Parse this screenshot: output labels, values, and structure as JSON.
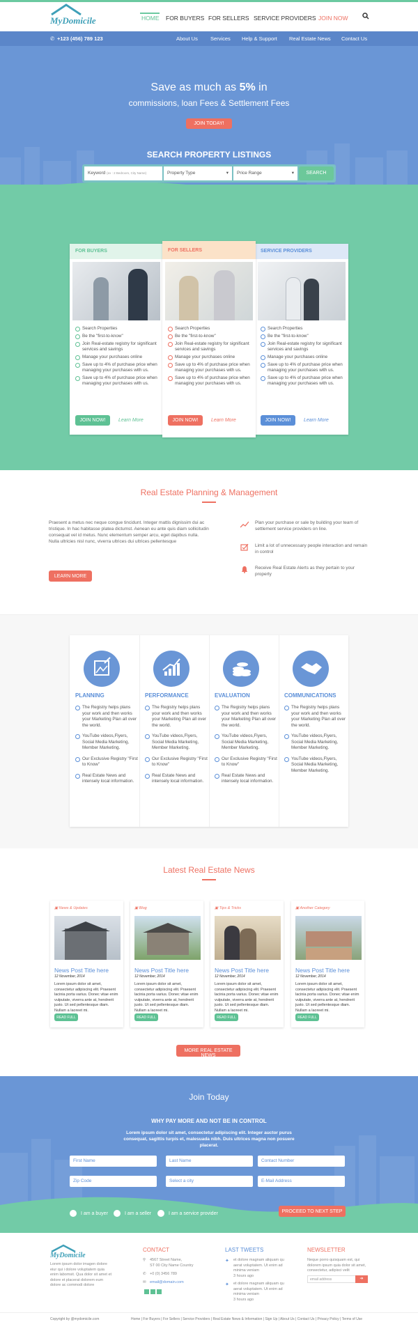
{
  "brand": {
    "name": "MyDomicile"
  },
  "nav": {
    "items": [
      "HOME",
      "FOR BUYERS",
      "FOR SELLERS",
      "SERVICE PROVIDERS",
      "JOIN NOW"
    ],
    "search_icon": "search-icon"
  },
  "subnav": {
    "phone": "+123 (456) 789 123",
    "items": [
      "About Us",
      "Services",
      "Help & Support",
      "Real Estate News",
      "Contact Us"
    ]
  },
  "hero": {
    "line1_prefix": "Save as much as ",
    "line1_bold": "5%",
    "line1_suffix": " in",
    "line2": "commissions, loan Fees & Settlement Fees",
    "cta": "JOIN TODAY!"
  },
  "search": {
    "title": "SEARCH PROPERTY LISTINGS",
    "keyword_label": "Keyword",
    "keyword_hint": "(ex : 2 Bedroom, City Name)",
    "property_type": "Property Type",
    "price_range": "Price Range",
    "button": "SEARCH"
  },
  "cards": [
    {
      "title": "FOR BUYERS",
      "items": [
        "Search Properties",
        "Be the \"first-to-know\"",
        "Join Real-estate registry for significant services and savings",
        "Manage your purchases online",
        "Save up to 4% of purchase price when managing your purchases with us.",
        "Save up to 4% of purchase price when managing your purchases with us."
      ],
      "button": "JOIN NOW!",
      "link": "Learn More"
    },
    {
      "title": "FOR SELLERS",
      "items": [
        "Search Properties",
        "Be the \"first-to-know\"",
        "Join Real-estate registry for significant services and savings",
        "Manage your purchases online",
        "Save up to 4% of purchase price when managing your purchases with us.",
        "Save up to 4% of purchase price when managing your purchases with us."
      ],
      "button": "JOIN NOW!",
      "link": "Learn More"
    },
    {
      "title": "SERVICE PROVIDERS",
      "items": [
        "Search Properties",
        "Be the \"first-to-know\"",
        "Join Real-estate registry for significant services and savings",
        "Manage your purchases online",
        "Save up to 4% of purchase price when managing your purchases with us.",
        "Save up to 4% of purchase price when managing your purchases with us."
      ],
      "button": "JOIN NOW!",
      "link": "Learn More"
    }
  ],
  "planning": {
    "title": "Real Estate Planning & Management",
    "paragraph": "Praesent a metus nec neque congue tincidunt. Integer mattis dignissim dui ac tristique. In hac habitasse platea dictumst. Aenean eu ante quis diam sollicitudin consequat vel id metus. Nunc elementum semper arcu, eget dapibus nulla. Nulla ultricies nisl nunc, viverra ultrices dui ultrices pellentesque",
    "button": "LEARN MORE",
    "points": [
      "Plan your purchase or sale by building your team of settlement service providers on line.",
      "Limit a lot of unnecessary people interaction and remain in control",
      "Receive Real Estate Alerts as they pertain to your property"
    ]
  },
  "features": [
    {
      "title": "PLANNING",
      "icon": "picture-edit-icon",
      "items": [
        "The Registry helps plans your work and then works your Marketing Plan all over the world.",
        "YouTube videos,Flyers, Social Media Marketing, Member Marketing.",
        "Our Exclusive Registry \"First to Know\"",
        "Real Estate News and intensely local information."
      ]
    },
    {
      "title": "PERFORMANCE",
      "icon": "chart-up-icon",
      "items": [
        "The Registry helps plans your work and then works your Marketing Plan all over the world.",
        "YouTube videos,Flyers, Social Media Marketing, Member Marketing.",
        "Our Exclusive Registry \"First to Know\"",
        "Real Estate News and intensely local information."
      ]
    },
    {
      "title": "EVALUATION",
      "icon": "coins-icon",
      "items": [
        "The Registry helps plans your work and then works your Marketing Plan all over the world.",
        "YouTube videos,Flyers, Social Media Marketing, Member Marketing.",
        "Our Exclusive Registry \"First to Know\"",
        "Real Estate News and intensely local information."
      ]
    },
    {
      "title": "COMMUNICATIONS",
      "icon": "handshake-icon",
      "items": [
        "The Registry helps plans your work and then works your Marketing Plan all over the world.",
        "YouTube videos,Flyers, Social Media Marketing, Member Marketing.",
        "YouTube videos,Flyers, Social Media Marketing, Member Marketing."
      ]
    }
  ],
  "news": {
    "title": "Latest Real Estate News",
    "posts": [
      {
        "category": "News & Updates",
        "title": "News Post Title here",
        "date": "12 November, 2014",
        "excerpt": "Lorem ipsum dolor sit amet, consectetur adipiscing elit. Praesent lacinia porta varius. Donec vitae enim vulputate, viverra ante at, hendrerit justo. Ut sed pellentesque diam. Nullam a laoreet mi.",
        "button": "READ FULL"
      },
      {
        "category": "Blog",
        "title": "News Post Title here",
        "date": "12 November, 2014",
        "excerpt": "Lorem ipsum dolor sit amet, consectetur adipiscing elit. Praesent lacinia porta varius. Donec vitae enim vulputate, viverra ante at, hendrerit justo. Ut sed pellentesque diam. Nullam a laoreet mi.",
        "button": "READ FULL"
      },
      {
        "category": "Tips & Tricks",
        "title": "News Post Title here",
        "date": "12 November, 2014",
        "excerpt": "Lorem ipsum dolor sit amet, consectetur adipiscing elit. Praesent lacinia porta varius. Donec vitae enim vulputate, viverra ante at, hendrerit justo. Ut sed pellentesque diam. Nullam a laoreet mi.",
        "button": "READ FULL"
      },
      {
        "category": "Another Category",
        "title": "News Post Title here",
        "date": "12 November, 2014",
        "excerpt": "Lorem ipsum dolor sit amet, consectetur adipiscing elit. Praesent lacinia porta varius. Donec vitae enim vulputate, viverra ante at, hendrerit justo. Ut sed pellentesque diam. Nullam a laoreet mi.",
        "button": "READ FULL"
      }
    ],
    "more_button": "MORE REAL ESTATE NEWS"
  },
  "join": {
    "title": "Join Today",
    "subtitle": "WHY PAY MORE AND NOT BE IN CONTROL",
    "text": "Lorem ipsum dolor sit amet, consectetur adipiscing elit. Integer auctor purus consequat, sagittis turpis et, malesuada nibh. Duis ultrices magna non posuere placerat.",
    "fields": [
      "First Name",
      "Last Name",
      "Contact Number",
      "Zip Code",
      "Select a city",
      "E-Mail Address"
    ],
    "radios": [
      "I am a buyer",
      "I am a seller",
      "I am a service provider"
    ],
    "button": "PROCEED TO NEXT STEP"
  },
  "footer": {
    "about": "Lorem ipsum dolor imagen dolore eiur qui i dolore voluptatem quia enim labomsit. Qua dolor sit amet et dolore et placerat dolorem eum dolore ac commodi dolore",
    "contact_title": "CONTACT",
    "contact_lines": [
      "4567 Street Name,",
      "ST 00 City Name Country",
      "+0 (0) 3456 789",
      "email@domain.com"
    ],
    "tweets_title": "LAST TWEETS",
    "tweets": [
      {
        "text": "et dolore magnam aliquam qu aerat voluptatem. Ut enim ad minima veniam",
        "time": "3 hours ago"
      },
      {
        "text": "et dolore magnam aliquam qu aerat voluptatem. Ut enim ad minima veniam",
        "time": "3 hours ago"
      }
    ],
    "newsletter_title": "NEWSLETTER",
    "newsletter_text": "Neque porro quisquam est, qui dolorem ipsum quia dolor sit amet, consectetur, adipisci velit",
    "newsletter_placeholder": "email address",
    "copyright": "Copyright by @mydomicile.com",
    "links": [
      "Home",
      "For Buyers",
      "For Sellers",
      "Service Providers",
      "Real Estate News & Information",
      "Sign Up",
      "About Us",
      "Contact Us",
      "Privacy Policy",
      "Terms of Use"
    ]
  },
  "colors": {
    "green": "#72cba7",
    "blue": "#6a96d6",
    "red": "#ee7061",
    "dark_blue": "#5b86c9"
  }
}
